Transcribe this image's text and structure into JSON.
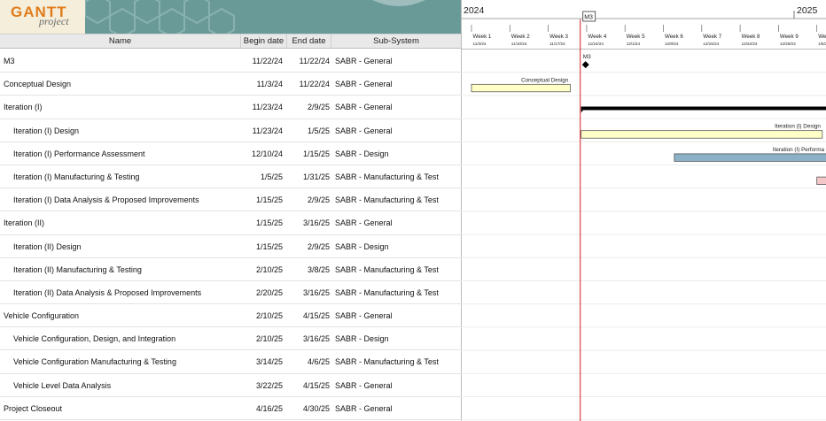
{
  "logo": {
    "word": "GANTT",
    "sub": "project"
  },
  "columns": {
    "name": "Name",
    "begin": "Begin date",
    "end": "End date",
    "sub": "Sub-System"
  },
  "tasks": [
    {
      "name": "M3",
      "begin": "11/22/24",
      "end": "11/22/24",
      "sub": "SABR - General",
      "indent": 0
    },
    {
      "name": "Conceptual Design",
      "begin": "11/3/24",
      "end": "11/22/24",
      "sub": "SABR - General",
      "indent": 0
    },
    {
      "name": "Iteration (I)",
      "begin": "11/23/24",
      "end": "2/9/25",
      "sub": "SABR - General",
      "indent": 0
    },
    {
      "name": "Iteration (I) Design",
      "begin": "11/23/24",
      "end": "1/5/25",
      "sub": "SABR - General",
      "indent": 1
    },
    {
      "name": "Iteration (I) Performance Assessment",
      "begin": "12/10/24",
      "end": "1/15/25",
      "sub": "SABR - Design",
      "indent": 1
    },
    {
      "name": "Iteration (I) Manufacturing & Testing",
      "begin": "1/5/25",
      "end": "1/31/25",
      "sub": "SABR - Manufacturing & Test",
      "indent": 1
    },
    {
      "name": "Iteration (I) Data Analysis & Proposed Improvements",
      "begin": "1/15/25",
      "end": "2/9/25",
      "sub": "SABR - Manufacturing & Test",
      "indent": 1
    },
    {
      "name": "Iteration (II)",
      "begin": "1/15/25",
      "end": "3/16/25",
      "sub": "SABR - General",
      "indent": 0
    },
    {
      "name": "Iteration (II) Design",
      "begin": "1/15/25",
      "end": "2/9/25",
      "sub": "SABR - Design",
      "indent": 1
    },
    {
      "name": "Iteration (II) Manufacturing & Testing",
      "begin": "2/10/25",
      "end": "3/8/25",
      "sub": "SABR - Manufacturing & Test",
      "indent": 1
    },
    {
      "name": "Iteration (II) Data Analysis & Proposed Improvements",
      "begin": "2/20/25",
      "end": "3/16/25",
      "sub": "SABR - Manufacturing & Test",
      "indent": 1
    },
    {
      "name": "Vehicle Configuration",
      "begin": "2/10/25",
      "end": "4/15/25",
      "sub": "SABR - General",
      "indent": 0
    },
    {
      "name": "Vehicle Configuration, Design, and Integration",
      "begin": "2/10/25",
      "end": "3/16/25",
      "sub": "SABR - Design",
      "indent": 1
    },
    {
      "name": "Vehicle Configuration Manufacturing & Testing",
      "begin": "3/14/25",
      "end": "4/6/25",
      "sub": "SABR - Manufacturing & Test",
      "indent": 1
    },
    {
      "name": "Vehicle Level Data Analysis",
      "begin": "3/22/25",
      "end": "4/15/25",
      "sub": "SABR - General",
      "indent": 1
    },
    {
      "name": "Project Closeout",
      "begin": "4/16/25",
      "end": "4/30/25",
      "sub": "SABR - General",
      "indent": 0
    }
  ],
  "timeline": {
    "year_left": "2024",
    "year_right": "2025",
    "milestone_marker": "M3",
    "weeks": [
      {
        "label": "Week 1",
        "date": "11/3/24"
      },
      {
        "label": "Week 2",
        "date": "11/10/24"
      },
      {
        "label": "Week 3",
        "date": "11/17/24"
      },
      {
        "label": "Week 4",
        "date": "11/24/24"
      },
      {
        "label": "Week 5",
        "date": "12/1/24"
      },
      {
        "label": "Week 6",
        "date": "12/8/24"
      },
      {
        "label": "Week 7",
        "date": "12/15/24"
      },
      {
        "label": "Week 8",
        "date": "12/22/24"
      },
      {
        "label": "Week 9",
        "date": "12/29/24"
      },
      {
        "label": "We",
        "date": "1/5/25"
      }
    ],
    "bar_labels": {
      "milestone": "M3",
      "conceptual": "Conceptual Design",
      "iter1_design": "Iteration (I) Design",
      "iter1_perf": "Iteration (I) Performa"
    }
  },
  "colors": {
    "banner": "#6a9a98",
    "task_yellow": "#ffffc8",
    "task_blue": "#8cb0c6",
    "task_pink": "#f4c8c8",
    "today_line": "#d02020",
    "summary_bar": "#000000"
  }
}
